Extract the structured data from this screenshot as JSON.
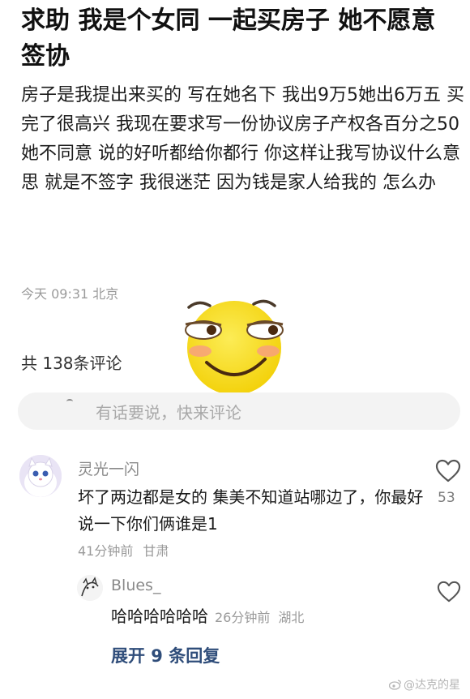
{
  "post": {
    "title": "求助 我是个女同 一起买房子 她不愿意签协",
    "body": "房子是我提出来买的 写在她名下 我出9万5她出6万五 买完了很高兴 我现在要求写一份协议房子产权各百分之50 她不同意 说的好听都给你都行 你这样让我写协议什么意思 就是不签字 我很迷茫 因为钱是家人给我的 怎么办",
    "time": "今天 09:31 北京"
  },
  "comments_section": {
    "count_label": "共 138条评论",
    "input_placeholder": "有话要说，快来评论"
  },
  "comments": [
    {
      "user": "灵光一闪",
      "text": "坏了两边都是女的 集美不知道站哪边了，你最好说一下你们俩谁是1",
      "time": "41分钟前",
      "location": "甘肃",
      "likes": "53"
    },
    {
      "user": "Blues_",
      "text": "哈哈哈哈哈哈",
      "time": "26分钟前",
      "location": "湖北"
    }
  ],
  "expand_replies": "展开 9 条回复",
  "watermark": "@达克的星",
  "icons": {
    "emoji": "smirk-face-emoji",
    "like": "heart-outline-icon",
    "watermark": "weibo-logo-icon"
  },
  "colors": {
    "link": "#2f4d7a",
    "meta": "#9a9a9a",
    "emoji_face": "#f9dd18"
  }
}
